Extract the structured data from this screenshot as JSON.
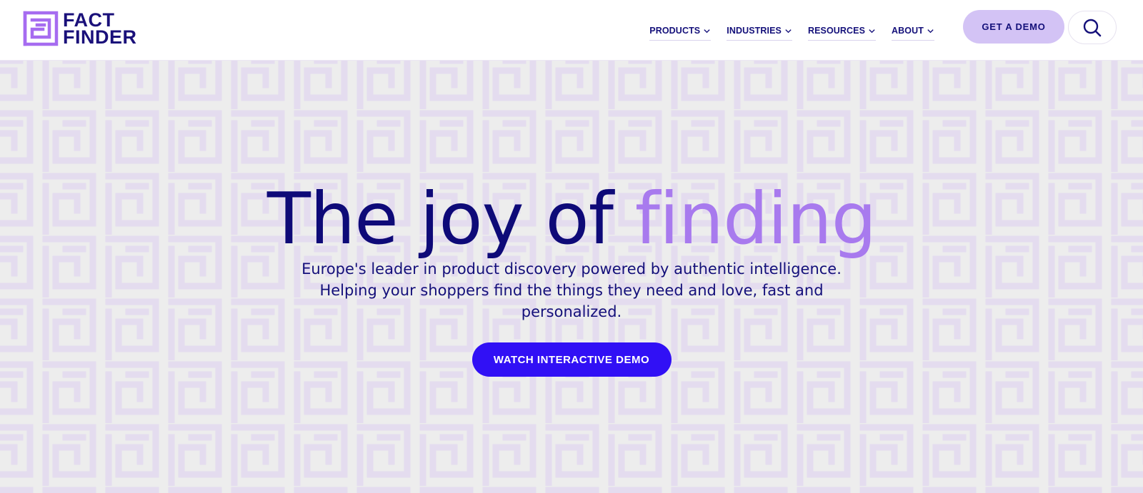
{
  "brand": {
    "name_line1": "FACT",
    "name_line2": "FINDER",
    "logo_icon": "maze-logo-icon"
  },
  "nav": {
    "items": [
      {
        "label": "PRODUCTS",
        "icon": "chevron-down-icon"
      },
      {
        "label": "INDUSTRIES",
        "icon": "chevron-down-icon"
      },
      {
        "label": "RESOURCES",
        "icon": "chevron-down-icon"
      },
      {
        "label": "ABOUT",
        "icon": "chevron-down-icon"
      }
    ],
    "demo_label": "GET A DEMO",
    "search_icon": "search-icon"
  },
  "hero": {
    "headline_main": "The joy of",
    "headline_accent": "finding",
    "subtext": "Europe's leader in product discovery powered by authentic intelligence. Helping your shoppers find the things they need and love, fast and personalized.",
    "cta_label": "WATCH INTERACTIVE DEMO"
  },
  "colors": {
    "primary": "#0e0a78",
    "accent": "#a87aee",
    "cta": "#3110f5",
    "demo_button": "#d3c3f5",
    "background": "#ededed"
  }
}
